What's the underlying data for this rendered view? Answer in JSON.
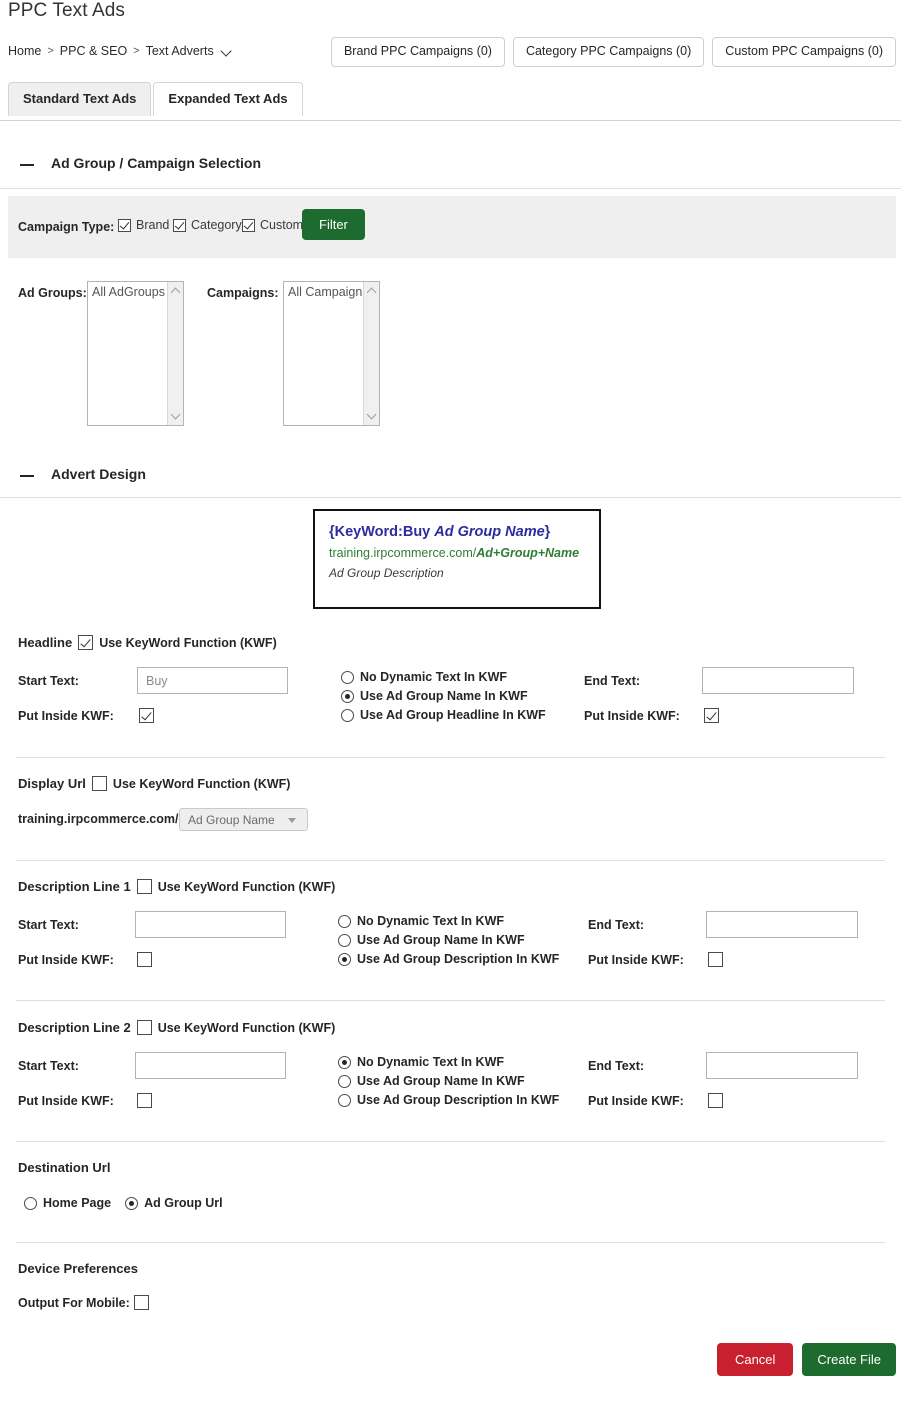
{
  "header": {
    "title": "PPC Text Ads",
    "breadcrumb": [
      "Home",
      "PPC & SEO",
      "Text Adverts"
    ],
    "separator": ">",
    "buttons": [
      "Brand PPC Campaigns (0)",
      "Category PPC Campaigns (0)",
      "Custom PPC Campaigns (0)"
    ]
  },
  "tabs": [
    {
      "label": "Standard Text Ads",
      "active": true
    },
    {
      "label": "Expanded Text Ads",
      "active": false
    }
  ],
  "sections": {
    "selection": {
      "title": "Ad Group / Campaign Selection",
      "toggle": "collapse-minus"
    },
    "design": {
      "title": "Advert Design",
      "toggle": "collapse-minus"
    }
  },
  "filter": {
    "label": "Campaign Type:",
    "options": [
      {
        "label": "Brand",
        "checked": true
      },
      {
        "label": "Category",
        "checked": true
      },
      {
        "label": "Custom",
        "checked": true
      }
    ],
    "button": "Filter",
    "button_color": "#1d6b2e"
  },
  "lists": {
    "adgroups": {
      "label": "Ad Groups:",
      "value": "All AdGroups"
    },
    "campaigns": {
      "label": "Campaigns:",
      "value": "All Campaigns"
    }
  },
  "preview": {
    "headline_start": "{KeyWord:Buy ",
    "headline_dynamic": "Ad Group Name",
    "headline_end": "}",
    "url_base": "training.irpcommerce.com/",
    "url_dynamic": "Ad+Group+Name",
    "description": "Ad Group Description",
    "headline_color": "#2c2ca0",
    "url_color": "#2f7d34"
  },
  "headline": {
    "title": "Headline",
    "kwf_label": "Use KeyWord Function (KWF)",
    "kwf_checked": true,
    "start_label": "Start Text:",
    "start_value": "Buy",
    "start_inside_label": "Put Inside KWF:",
    "start_inside_checked": true,
    "radios": [
      {
        "label": "No Dynamic Text In KWF",
        "selected": false
      },
      {
        "label": "Use Ad Group Name In KWF",
        "selected": true
      },
      {
        "label": "Use Ad Group Headline In KWF",
        "selected": false
      }
    ],
    "end_label": "End Text:",
    "end_value": "",
    "end_inside_label": "Put Inside KWF:",
    "end_inside_checked": true
  },
  "display_url": {
    "title": "Display Url",
    "kwf_label": "Use KeyWord Function (KWF)",
    "kwf_checked": false,
    "base": "training.irpcommerce.com/",
    "select_value": "Ad Group Name"
  },
  "description1": {
    "title": "Description Line 1",
    "kwf_label": "Use KeyWord Function (KWF)",
    "kwf_checked": false,
    "start_label": "Start Text:",
    "start_value": "",
    "start_inside_label": "Put Inside KWF:",
    "start_inside_checked": false,
    "radios": [
      {
        "label": "No Dynamic Text In KWF",
        "selected": false
      },
      {
        "label": "Use Ad Group Name In KWF",
        "selected": false
      },
      {
        "label": "Use Ad Group Description In KWF",
        "selected": true
      }
    ],
    "end_label": "End Text:",
    "end_value": "",
    "end_inside_label": "Put Inside KWF:",
    "end_inside_checked": false
  },
  "description2": {
    "title": "Description Line 2",
    "kwf_label": "Use KeyWord Function (KWF)",
    "kwf_checked": false,
    "start_label": "Start Text:",
    "start_value": "",
    "start_inside_label": "Put Inside KWF:",
    "start_inside_checked": false,
    "radios": [
      {
        "label": "No Dynamic Text In KWF",
        "selected": true
      },
      {
        "label": "Use Ad Group Name In KWF",
        "selected": false
      },
      {
        "label": "Use Ad Group Description In KWF",
        "selected": false
      }
    ],
    "end_label": "End Text:",
    "end_value": "",
    "end_inside_label": "Put Inside KWF:",
    "end_inside_checked": false
  },
  "destination": {
    "title": "Destination Url",
    "radios": [
      {
        "label": "Home Page",
        "selected": false
      },
      {
        "label": "Ad Group Url",
        "selected": true
      }
    ]
  },
  "device": {
    "title": "Device Preferences",
    "mobile_label": "Output For Mobile:",
    "mobile_checked": false
  },
  "footer": {
    "cancel": "Cancel",
    "create": "Create File",
    "cancel_color": "#c8202e",
    "create_color": "#1d6b2e"
  }
}
